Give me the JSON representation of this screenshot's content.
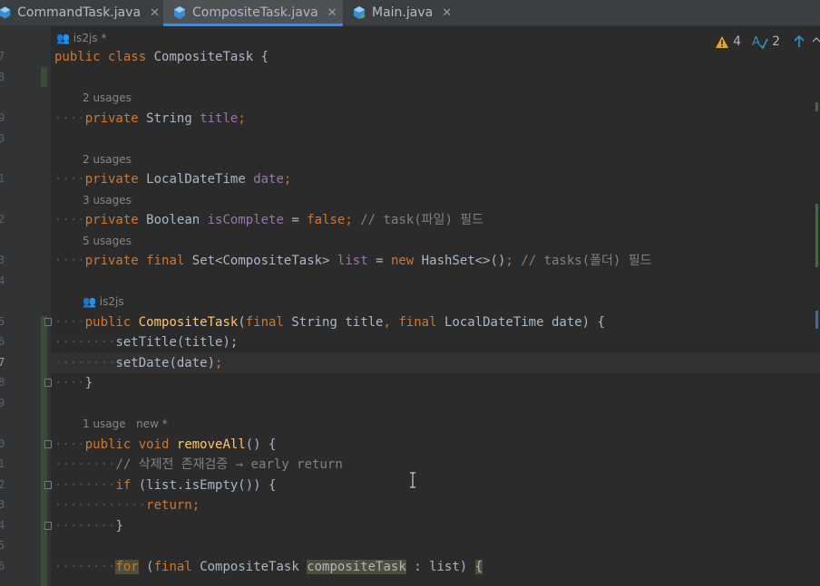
{
  "tabs": [
    {
      "label": "CommandTask.java",
      "close": "✕",
      "active": false
    },
    {
      "label": "CompositeTask.java",
      "close": "✕",
      "active": true
    },
    {
      "label": "Main.java",
      "close": "✕",
      "active": false
    }
  ],
  "inspections": {
    "warnings": "4",
    "typos": "2"
  },
  "colors": {
    "keyword": "#cc7832",
    "field": "#9876aa",
    "method": "#ffc66d",
    "comment": "#808080",
    "text": "#a9b7c6",
    "background": "#2b2b2b"
  },
  "line_numbers": [
    "7",
    "8",
    "9",
    "0",
    "1",
    "2",
    "3",
    "4",
    "5",
    "6",
    "7",
    "8",
    "9",
    "0",
    "1",
    "2",
    "3",
    "4",
    "5",
    "6"
  ],
  "hints": {
    "author_class": "is2js *",
    "usages_title": "2 usages",
    "usages_date": "2 usages",
    "usages_complete": "3 usages",
    "usages_list": "5 usages",
    "author_ctor": "is2js",
    "usages_remove": "1 usage",
    "new_remove": "new *"
  },
  "code": {
    "class_decl": {
      "kw1": "public",
      "kw2": "class",
      "name": "CompositeTask {"
    },
    "title": {
      "kw": "private",
      "type": "String",
      "name": "title",
      "end": ";"
    },
    "date": {
      "kw": "private",
      "type": "LocalDateTime",
      "name": "date",
      "end": ";"
    },
    "complete": {
      "kw": "private",
      "type": "Boolean",
      "name": "isComplete",
      "eq": " = ",
      "val": "false",
      "end": ";",
      "comment": "// task(파일) 필드"
    },
    "list": {
      "kw1": "private",
      "kw2": "final",
      "type": "Set<CompositeTask>",
      "name": "list",
      "eq": " = ",
      "kw3": "new",
      "init": "HashSet<>()",
      "end": ";",
      "comment": "// tasks(폴더) 필드"
    },
    "ctor": {
      "kw": "public",
      "name": "CompositeTask",
      "open": "(",
      "p1kw": "final",
      "p1": "String title",
      "comma": ",",
      "p2kw": "final",
      "p2": "LocalDateTime date) {"
    },
    "set_title": "setTitle(title);",
    "set_date_call": "setDate(date)",
    "set_date_end": ";",
    "close1": "}",
    "remove": {
      "kw1": "public",
      "kw2": "void",
      "name": "removeAll",
      "rest": "() {"
    },
    "comment_check": "// 삭제전 존재검증 → early return",
    "if_kw": "if",
    "if_rest": " (list.isEmpty()) {",
    "return_kw": "return",
    "return_end": ";",
    "close2": "}",
    "for_kw": "for",
    "for_open": " (",
    "for_final": "final",
    "for_type": "CompositeTask",
    "for_var": "compositeTask",
    "for_colon": " : ",
    "for_list": "list",
    "for_paren": ")",
    "for_brace": "{"
  }
}
